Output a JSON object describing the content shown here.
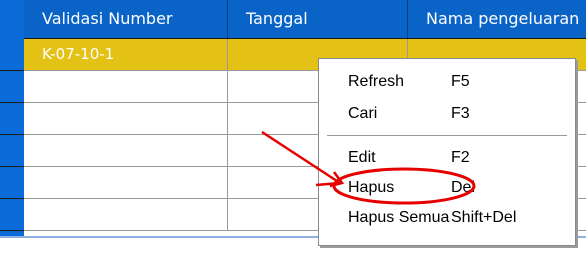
{
  "table": {
    "columns": [
      "Validasi Number",
      "Tanggal",
      "Nama pengeluaran"
    ],
    "rows": [
      [
        "K-07-10-1",
        "",
        ""
      ],
      [
        "",
        "",
        ""
      ],
      [
        "",
        "",
        ""
      ],
      [
        "",
        "",
        ""
      ],
      [
        "",
        "",
        ""
      ],
      [
        "",
        "",
        ""
      ]
    ]
  },
  "context_menu": {
    "items": [
      {
        "label": "Refresh",
        "shortcut": "F5"
      },
      {
        "label": "Cari",
        "shortcut": "F3"
      },
      {
        "label": "Edit",
        "shortcut": "F2"
      },
      {
        "label": "Hapus",
        "shortcut": "Del"
      },
      {
        "label": "Hapus Semua",
        "shortcut": "Shift+Del"
      }
    ]
  },
  "colors": {
    "header_bg": "#0a64c8",
    "selected_row": "#e3c215",
    "annotation": "#e60000"
  }
}
